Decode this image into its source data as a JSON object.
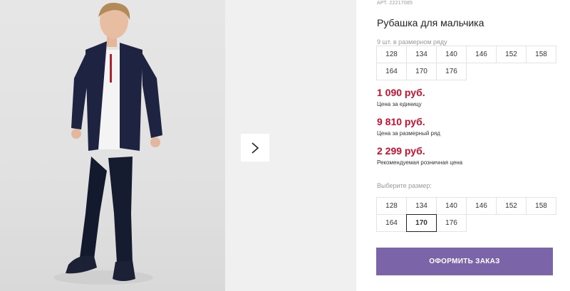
{
  "product": {
    "article": "АРТ. 22217085",
    "title": "Рубашка для мальчика",
    "image_alt": "product-photo"
  },
  "size_range": {
    "label": "9 шт. в размерном ряду",
    "sizes": [
      "128",
      "134",
      "140",
      "146",
      "152",
      "158",
      "164",
      "170",
      "176"
    ]
  },
  "prices": {
    "unit_price": "1 090 руб.",
    "unit_note": "Цена за единицу",
    "range_price": "9 810 руб.",
    "range_note": "Цена за размерный ряд",
    "retail_price": "2 299 руб.",
    "retail_note": "Рекомендуемая розничная цена"
  },
  "size_select": {
    "label": "Выберите размер:",
    "sizes": [
      "128",
      "134",
      "140",
      "146",
      "152",
      "158",
      "164",
      "170",
      "176"
    ],
    "selected": "170"
  },
  "actions": {
    "order_label": "ОФОРМИТЬ ЗАКАЗ"
  },
  "colors": {
    "accent": "#7b64a8",
    "price": "#c8102e"
  }
}
